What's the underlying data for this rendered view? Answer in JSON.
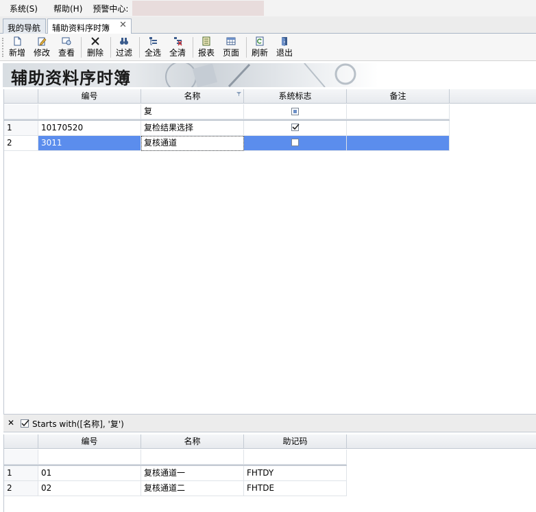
{
  "menu": {
    "items": [
      "系统(S)",
      "帮助(H)",
      "预警中心:"
    ]
  },
  "tabs": {
    "nav": "我的导航",
    "active": "辅助资料序时簿",
    "close_glyph": "✕"
  },
  "toolbar": {
    "new": "新增",
    "edit": "修改",
    "view": "查看",
    "delete": "删除",
    "filter": "过滤",
    "select_all": "全选",
    "clear_all": "全清",
    "report": "报表",
    "page": "页面",
    "refresh": "刷新",
    "exit": "退出"
  },
  "banner": {
    "title": "辅助资料序时簿"
  },
  "main_grid": {
    "columns": [
      "编号",
      "名称",
      "系统标志",
      "备注"
    ],
    "filter_row": {
      "name": "复"
    },
    "rows": [
      {
        "index": "1",
        "code": "10170520",
        "name": "复检结果选择",
        "system": true,
        "note": ""
      },
      {
        "index": "2",
        "code": "3011",
        "name": "复核通道",
        "system": false,
        "note": ""
      }
    ]
  },
  "filter_status": {
    "close_glyph": "✕",
    "expression": "Starts with([名称], '复')"
  },
  "detail_grid": {
    "columns": [
      "编号",
      "名称",
      "助记码"
    ],
    "rows": [
      {
        "index": "1",
        "code": "01",
        "name": "复核通道一",
        "mnemonic": "FHTDY"
      },
      {
        "index": "2",
        "code": "02",
        "name": "复核通道二",
        "mnemonic": "FHTDE"
      }
    ]
  },
  "colors": {
    "selection": "#5b8ded",
    "header": "#e7eaee"
  }
}
